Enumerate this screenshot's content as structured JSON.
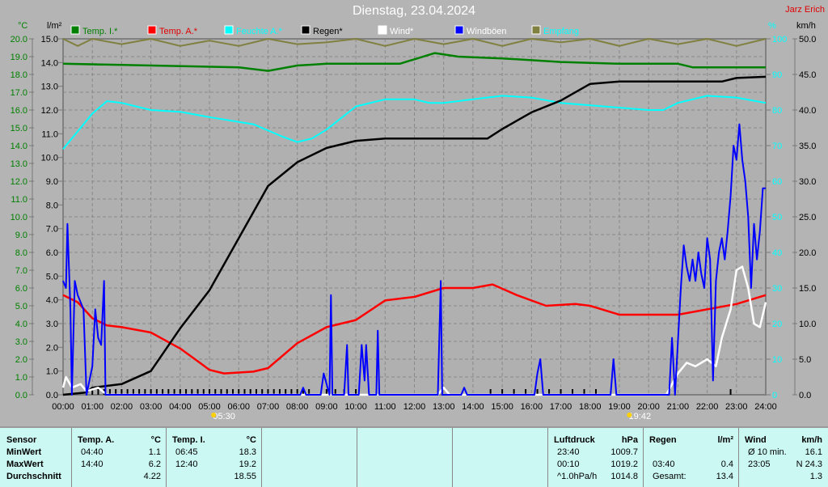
{
  "title": "Dienstag, 23.04.2024",
  "author": "Jarz Erich",
  "chart_data": {
    "type": "line",
    "x_unit": "hour",
    "x_ticks": [
      "00:00",
      "01:00",
      "02:00",
      "03:00",
      "04:00",
      "05:00",
      "06:00",
      "07:00",
      "08:00",
      "09:00",
      "10:00",
      "11:00",
      "12:00",
      "13:00",
      "14:00",
      "15:00",
      "16:00",
      "17:00",
      "18:00",
      "19:00",
      "20:00",
      "21:00",
      "22:00",
      "23:00",
      "24:00"
    ],
    "axes": {
      "temp": {
        "label": "°C",
        "range": [
          0,
          20
        ],
        "ticks": [
          "0.0",
          "1.0",
          "2.0",
          "3.0",
          "4.0",
          "5.0",
          "6.0",
          "7.0",
          "8.0",
          "9.0",
          "10.0",
          "11.0",
          "12.0",
          "13.0",
          "14.0",
          "15.0",
          "16.0",
          "17.0",
          "18.0",
          "19.0",
          "20.0"
        ]
      },
      "rain": {
        "label": "l/m²",
        "range": [
          0,
          15
        ],
        "ticks": [
          "0.0",
          "1.0",
          "2.0",
          "3.0",
          "4.0",
          "5.0",
          "6.0",
          "7.0",
          "8.0",
          "9.0",
          "10.0",
          "11.0",
          "12.0",
          "13.0",
          "14.0",
          "15.0"
        ]
      },
      "humidity": {
        "label": "%",
        "range": [
          0,
          100
        ],
        "ticks": [
          "0",
          "10",
          "20",
          "30",
          "40",
          "50",
          "60",
          "70",
          "80",
          "90",
          "100"
        ]
      },
      "wind": {
        "label": "km/h",
        "range": [
          0,
          50
        ],
        "ticks": [
          "0.0",
          "5.0",
          "10.0",
          "15.0",
          "20.0",
          "25.0",
          "30.0",
          "35.0",
          "40.0",
          "45.0",
          "50.0"
        ]
      }
    },
    "sun_markers": [
      {
        "label": "05:30",
        "hour": 5.5
      },
      {
        "label": "19:42",
        "hour": 19.7
      }
    ],
    "series": [
      {
        "name": "Temp. I.*",
        "color": "#008000",
        "axis": "temp",
        "points": [
          [
            0,
            18.6
          ],
          [
            6,
            18.4
          ],
          [
            7,
            18.2
          ],
          [
            8,
            18.5
          ],
          [
            9,
            18.6
          ],
          [
            11.5,
            18.6
          ],
          [
            12.7,
            19.2
          ],
          [
            13.5,
            19.0
          ],
          [
            15,
            18.9
          ],
          [
            17,
            18.7
          ],
          [
            19,
            18.6
          ],
          [
            21,
            18.6
          ],
          [
            21.5,
            18.4
          ],
          [
            24,
            18.4
          ]
        ]
      },
      {
        "name": "Temp. A.*",
        "color": "#ff0000",
        "axis": "temp",
        "points": [
          [
            0,
            5.6
          ],
          [
            0.5,
            5.2
          ],
          [
            1,
            4.3
          ],
          [
            1.5,
            3.9
          ],
          [
            2,
            3.8
          ],
          [
            3,
            3.5
          ],
          [
            4,
            2.6
          ],
          [
            4.67,
            1.8
          ],
          [
            5,
            1.4
          ],
          [
            5.5,
            1.2
          ],
          [
            6.5,
            1.3
          ],
          [
            7,
            1.5
          ],
          [
            8,
            2.9
          ],
          [
            9,
            3.8
          ],
          [
            10,
            4.2
          ],
          [
            11,
            5.3
          ],
          [
            12,
            5.5
          ],
          [
            13,
            6.0
          ],
          [
            14,
            6.0
          ],
          [
            14.67,
            6.2
          ],
          [
            15.5,
            5.6
          ],
          [
            16.5,
            5.0
          ],
          [
            17.5,
            5.1
          ],
          [
            18,
            5.0
          ],
          [
            19,
            4.5
          ],
          [
            21,
            4.5
          ],
          [
            22,
            4.8
          ],
          [
            23,
            5.1
          ],
          [
            24,
            5.6
          ]
        ]
      },
      {
        "name": "Feuchte A.*",
        "color": "#00ffff",
        "axis": "humidity",
        "points": [
          [
            0,
            69
          ],
          [
            0.5,
            74
          ],
          [
            1,
            79
          ],
          [
            1.5,
            82.5
          ],
          [
            2,
            82
          ],
          [
            3,
            80
          ],
          [
            4,
            79.5
          ],
          [
            5,
            78
          ],
          [
            6.5,
            76
          ],
          [
            7.5,
            72.5
          ],
          [
            8,
            71
          ],
          [
            8.5,
            72
          ],
          [
            9,
            74.5
          ],
          [
            10,
            81
          ],
          [
            11,
            83
          ],
          [
            12,
            83
          ],
          [
            12.5,
            82
          ],
          [
            13,
            82
          ],
          [
            14,
            83
          ],
          [
            15,
            84
          ],
          [
            16,
            83.5
          ],
          [
            17,
            82
          ],
          [
            18.5,
            81
          ],
          [
            20,
            80
          ],
          [
            20.5,
            80
          ],
          [
            21,
            82
          ],
          [
            22,
            84
          ],
          [
            23,
            83.5
          ],
          [
            24,
            82
          ]
        ]
      },
      {
        "name": "Regen*",
        "color": "#000000",
        "axis": "rain",
        "points": [
          [
            0,
            0
          ],
          [
            0.8,
            0.1
          ],
          [
            1,
            0.3
          ],
          [
            2,
            0.45
          ],
          [
            3,
            1.0
          ],
          [
            4,
            2.8
          ],
          [
            5,
            4.4
          ],
          [
            6,
            6.6
          ],
          [
            7,
            8.8
          ],
          [
            8,
            9.8
          ],
          [
            9,
            10.4
          ],
          [
            10,
            10.7
          ],
          [
            11,
            10.8
          ],
          [
            14.5,
            10.8
          ],
          [
            15,
            11.2
          ],
          [
            16,
            11.9
          ],
          [
            17,
            12.4
          ],
          [
            18,
            13.1
          ],
          [
            19,
            13.2
          ],
          [
            22.5,
            13.2
          ],
          [
            23,
            13.35
          ],
          [
            24,
            13.4
          ]
        ]
      },
      {
        "name": "Wind*",
        "color": "#ffffff",
        "axis": "wind",
        "points": [
          [
            0,
            1
          ],
          [
            0.1,
            2.5
          ],
          [
            0.3,
            1
          ],
          [
            0.6,
            1.5
          ],
          [
            0.8,
            0.5
          ],
          [
            1.2,
            1
          ],
          [
            1.5,
            0
          ],
          [
            12.8,
            0
          ],
          [
            13,
            1
          ],
          [
            13.2,
            0
          ],
          [
            20.6,
            0
          ],
          [
            21,
            3
          ],
          [
            21.3,
            4.5
          ],
          [
            21.6,
            4
          ],
          [
            22,
            5
          ],
          [
            22.3,
            4
          ],
          [
            22.5,
            8
          ],
          [
            22.8,
            12
          ],
          [
            23,
            17.5
          ],
          [
            23.2,
            18
          ],
          [
            23.4,
            15
          ],
          [
            23.6,
            10
          ],
          [
            23.8,
            9.5
          ],
          [
            24,
            13
          ]
        ]
      },
      {
        "name": "Windböen",
        "color": "#0000ff",
        "axis": "wind",
        "points": [
          [
            0,
            16
          ],
          [
            0.1,
            15
          ],
          [
            0.15,
            24
          ],
          [
            0.25,
            12
          ],
          [
            0.3,
            0
          ],
          [
            0.4,
            16
          ],
          [
            0.5,
            14
          ],
          [
            0.7,
            12
          ],
          [
            0.8,
            0
          ],
          [
            1,
            4
          ],
          [
            1.1,
            12
          ],
          [
            1.2,
            8
          ],
          [
            1.3,
            7
          ],
          [
            1.4,
            16
          ],
          [
            1.45,
            0
          ],
          [
            8.1,
            0
          ],
          [
            8.2,
            1
          ],
          [
            8.3,
            0
          ],
          [
            8.8,
            0
          ],
          [
            8.9,
            3
          ],
          [
            9.1,
            0
          ],
          [
            9.15,
            14
          ],
          [
            9.2,
            0
          ],
          [
            9.6,
            0
          ],
          [
            9.7,
            7
          ],
          [
            9.75,
            0
          ],
          [
            10.1,
            0
          ],
          [
            10.2,
            7
          ],
          [
            10.3,
            2
          ],
          [
            10.35,
            7
          ],
          [
            10.45,
            0
          ],
          [
            10.7,
            0
          ],
          [
            10.75,
            9
          ],
          [
            10.8,
            0
          ],
          [
            12.8,
            0
          ],
          [
            12.9,
            16
          ],
          [
            12.95,
            0
          ],
          [
            13.6,
            0
          ],
          [
            13.7,
            1
          ],
          [
            13.8,
            0
          ],
          [
            16.1,
            0
          ],
          [
            16.2,
            3
          ],
          [
            16.3,
            5
          ],
          [
            16.4,
            0
          ],
          [
            18.7,
            0
          ],
          [
            18.8,
            5
          ],
          [
            18.9,
            0
          ],
          [
            20.7,
            0
          ],
          [
            20.8,
            8
          ],
          [
            20.9,
            0
          ],
          [
            21.1,
            15
          ],
          [
            21.2,
            21
          ],
          [
            21.3,
            18
          ],
          [
            21.4,
            16
          ],
          [
            21.5,
            19
          ],
          [
            21.6,
            16
          ],
          [
            21.7,
            20
          ],
          [
            21.8,
            17
          ],
          [
            21.9,
            15
          ],
          [
            22,
            22
          ],
          [
            22.1,
            19
          ],
          [
            22.2,
            2
          ],
          [
            22.3,
            16
          ],
          [
            22.4,
            20
          ],
          [
            22.5,
            22
          ],
          [
            22.6,
            19
          ],
          [
            22.7,
            23
          ],
          [
            22.8,
            28
          ],
          [
            22.9,
            35
          ],
          [
            23,
            33
          ],
          [
            23.1,
            38
          ],
          [
            23.2,
            33
          ],
          [
            23.3,
            30
          ],
          [
            23.4,
            25
          ],
          [
            23.5,
            15
          ],
          [
            23.6,
            24
          ],
          [
            23.7,
            19
          ],
          [
            23.8,
            23
          ],
          [
            23.9,
            29
          ],
          [
            24,
            29
          ]
        ]
      },
      {
        "name": "Empfang",
        "color": "#808040",
        "axis": "humidity",
        "points": [
          [
            0,
            100
          ],
          [
            0.5,
            98
          ],
          [
            1,
            100
          ],
          [
            2,
            98.5
          ],
          [
            3,
            100
          ],
          [
            4,
            98
          ],
          [
            5,
            99.5
          ],
          [
            6,
            98
          ],
          [
            7,
            100
          ],
          [
            8,
            98.5
          ],
          [
            9,
            99
          ],
          [
            10,
            100
          ],
          [
            11,
            98
          ],
          [
            12,
            100
          ],
          [
            13,
            98.5
          ],
          [
            14,
            100
          ],
          [
            15,
            98
          ],
          [
            16,
            100
          ],
          [
            17,
            99
          ],
          [
            18,
            100
          ],
          [
            19,
            98
          ],
          [
            20,
            100
          ],
          [
            21,
            98.5
          ],
          [
            22,
            100
          ],
          [
            23,
            98
          ],
          [
            24,
            100
          ]
        ]
      }
    ],
    "rain_ticks_hours": [
      1,
      1.2,
      1.4,
      1.6,
      1.8,
      2,
      2.2,
      2.4,
      2.6,
      2.8,
      3,
      3.2,
      3.4,
      3.6,
      3.8,
      4,
      4.2,
      4.4,
      4.6,
      4.8,
      5,
      5.2,
      5.4,
      5.6,
      5.8,
      6,
      6.2,
      6.4,
      6.6,
      6.8,
      7,
      7.2,
      7.4,
      7.6,
      7.8,
      8,
      8.2,
      8.4,
      9,
      9.3,
      9.6,
      10,
      14.6,
      15,
      15.4,
      15.8,
      16.2,
      16.6,
      17,
      17.4,
      17.8,
      18.2,
      22.8
    ]
  },
  "table": {
    "sensor": {
      "header": "Sensor",
      "rows": [
        "MinWert",
        "MaxWert",
        "Durchschnitt"
      ]
    },
    "temp_a": {
      "header": "Temp. A.",
      "unit": "°C",
      "times": [
        "04:40",
        "14:40",
        ""
      ],
      "values": [
        "1.1",
        "6.2",
        "4.22"
      ]
    },
    "temp_i": {
      "header": "Temp. I.",
      "unit": "°C",
      "times": [
        "06:45",
        "12:40",
        ""
      ],
      "values": [
        "18.3",
        "19.2",
        "18.55"
      ]
    },
    "pressure": {
      "header": "Luftdruck",
      "unit": "hPa",
      "times": [
        "23:40",
        "00:10",
        "^1.0hPa/h"
      ],
      "values": [
        "1009.7",
        "1019.2",
        "1014.8"
      ]
    },
    "rain": {
      "header": "Regen",
      "unit": "l/m²",
      "times": [
        "",
        "03:40",
        "Gesamt:"
      ],
      "values": [
        "",
        "0.4",
        "13.4"
      ]
    },
    "wind": {
      "header": "Wind",
      "unit": "km/h",
      "times": [
        "Ø 10 min.",
        "23:05",
        ""
      ],
      "values": [
        "16.1",
        "N 24.3",
        "1.3"
      ]
    }
  }
}
